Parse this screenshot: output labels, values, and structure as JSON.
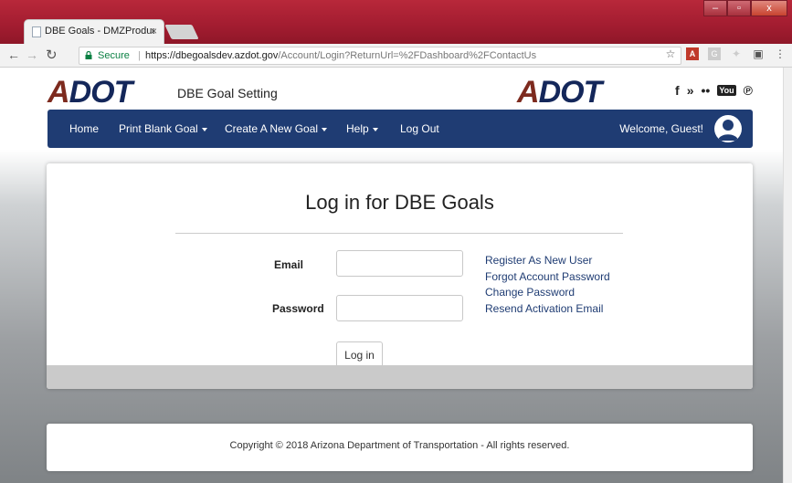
{
  "browser": {
    "tab_title": "DBE Goals - DMZProduc",
    "tab_close": "×",
    "secure_label": "Secure",
    "url_host": "https://dbegoalsdev.azdot.gov",
    "url_path": "/Account/Login?ReturnUrl=%2FDashboard%2FContactUs",
    "window_buttons": [
      "–",
      "▫",
      "x"
    ]
  },
  "brand": {
    "logo_a": "A",
    "logo_rest": "DOT",
    "subtitle": "DBE Goal Setting",
    "social": [
      "f",
      "»",
      "••",
      "You",
      "℗"
    ]
  },
  "nav": {
    "items": [
      {
        "label": "Home",
        "dropdown": false
      },
      {
        "label": "Print Blank Goal",
        "dropdown": true
      },
      {
        "label": "Create A New Goal",
        "dropdown": true
      },
      {
        "label": "Help",
        "dropdown": true
      },
      {
        "label": "Log Out",
        "dropdown": false
      }
    ],
    "welcome": "Welcome, Guest!"
  },
  "login": {
    "title": "Log in for DBE Goals",
    "email_label": "Email",
    "email_value": "",
    "password_label": "Password",
    "password_value": "",
    "button": "Log in",
    "links": [
      "Register As New User",
      "Forgot Account Password",
      "Change Password",
      "Resend Activation Email"
    ]
  },
  "footer": {
    "copyright": "Copyright © 2018 Arizona Department of Transportation - All rights reserved."
  },
  "colors": {
    "navbar": "#1f3c73",
    "logo_red": "#7d2a1e",
    "logo_blue": "#14275a",
    "chrome_red": "#a21c30"
  }
}
